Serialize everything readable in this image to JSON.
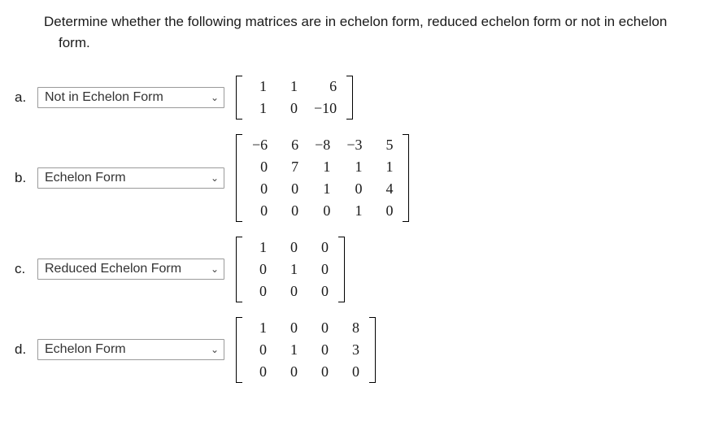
{
  "instruction": "Determine whether the following matrices are in echelon form, reduced echelon form or not in echelon form.",
  "items": [
    {
      "label": "a.",
      "selected": "Not in Echelon Form",
      "matrix": [
        [
          "1",
          "1",
          "6"
        ],
        [
          "1",
          "0",
          "−10"
        ]
      ]
    },
    {
      "label": "b.",
      "selected": "Echelon Form",
      "matrix": [
        [
          "−6",
          "6",
          "−8",
          "−3",
          "5"
        ],
        [
          "0",
          "7",
          "1",
          "1",
          "1"
        ],
        [
          "0",
          "0",
          "1",
          "0",
          "4"
        ],
        [
          "0",
          "0",
          "0",
          "1",
          "0"
        ]
      ]
    },
    {
      "label": "c.",
      "selected": "Reduced Echelon Form",
      "matrix": [
        [
          "1",
          "0",
          "0"
        ],
        [
          "0",
          "1",
          "0"
        ],
        [
          "0",
          "0",
          "0"
        ]
      ]
    },
    {
      "label": "d.",
      "selected": "Echelon Form",
      "matrix": [
        [
          "1",
          "0",
          "0",
          "8"
        ],
        [
          "0",
          "1",
          "0",
          "3"
        ],
        [
          "0",
          "0",
          "0",
          "0"
        ]
      ]
    }
  ]
}
